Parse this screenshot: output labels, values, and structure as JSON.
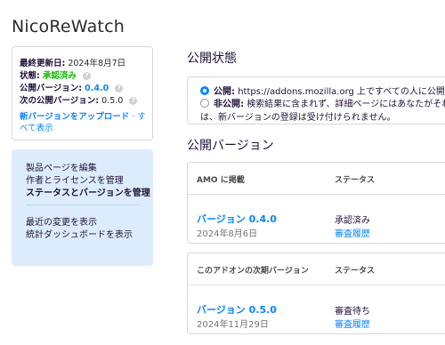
{
  "app": {
    "title": "NicoReWatch"
  },
  "info": {
    "last_updated_label": "最終更新日:",
    "last_updated_value": "2024年8月7日",
    "status_label": "状態:",
    "status_value": "承認済み",
    "public_version_label": "公開バージョン:",
    "public_version_value": "0.4.0",
    "next_version_label": "次の公開バージョン:",
    "next_version_value": "0.5.0",
    "upload_link": "新バージョンをアップロード",
    "separator": "·",
    "show_all_link": "すべて表示",
    "help_icon": "?"
  },
  "nav": {
    "items": [
      {
        "label": "製品ページを編集"
      },
      {
        "label": "作者とライセンスを管理"
      },
      {
        "label": "ステータスとバージョンを管理"
      },
      {
        "label": "最近の変更を表示"
      },
      {
        "label": "統計ダッシュボードを表示"
      }
    ]
  },
  "visibility": {
    "title": "公開状態",
    "public_label": "公開:",
    "public_desc": "https://addons.mozilla.org 上ですべての人に公開さ",
    "unlisted_label": "非公開:",
    "unlisted_desc": "検索結果に含まれず、詳細ページにはあなたがそれ",
    "unlisted_cont": "は、新バージョンの登録は受け付けられません。"
  },
  "versions": {
    "title": "公開バージョン",
    "listed": {
      "col_version": "AMO に掲載",
      "col_status": "ステータス",
      "version_link": "バージョン 0.4.0",
      "date": "2024年8月6日",
      "status": "承認済み",
      "review_link": "審査履歴"
    },
    "next": {
      "col_version": "このアドオンの次期バージョン",
      "col_status": "ステータス",
      "version_link": "バージョン 0.5.0",
      "date": "2024年11月29日",
      "status": "審査待ち",
      "review_link": "審査履歴"
    }
  }
}
